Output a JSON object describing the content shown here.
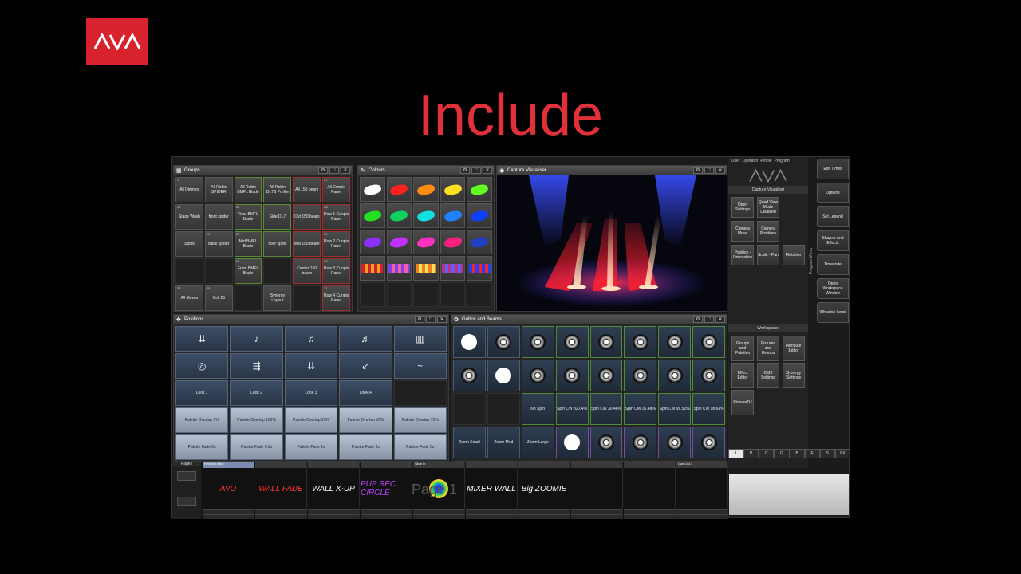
{
  "brand": {
    "logo_text": "AVO",
    "accent": "#d8232f"
  },
  "headline": "Include",
  "groups": {
    "title": "Groups",
    "cells": [
      {
        "n": "1",
        "label": "All Dimmer"
      },
      {
        "n": "",
        "label": "All Robin SPIDER"
      },
      {
        "n": "",
        "label": "All Robin BMFL Blade"
      },
      {
        "n": "",
        "label": "All Robin DL7S Profile"
      },
      {
        "n": "",
        "label": "All 150 beam"
      },
      {
        "n": "27",
        "label": "All Cunpix Panel"
      },
      {
        "n": "22",
        "label": "Stage Wash"
      },
      {
        "n": "",
        "label": "front spider"
      },
      {
        "n": "24",
        "label": "Rear BMFL Blade"
      },
      {
        "n": "",
        "label": "Side DL7"
      },
      {
        "n": "",
        "label": "Out 150 beam"
      },
      {
        "n": "28",
        "label": "Row 1 Cunpix Panel"
      },
      {
        "n": "",
        "label": "Spots"
      },
      {
        "n": "23",
        "label": "Back spider"
      },
      {
        "n": "25",
        "label": "Mid BMFL Blade"
      },
      {
        "n": "",
        "label": "floor spots"
      },
      {
        "n": "",
        "label": "Mid 150 beam"
      },
      {
        "n": "29",
        "label": "Row 2 Cunpix Panel"
      },
      {
        "n": "",
        "label": ""
      },
      {
        "n": "",
        "label": ""
      },
      {
        "n": "26",
        "label": "Front BMFL Blade"
      },
      {
        "n": "",
        "label": ""
      },
      {
        "n": "",
        "label": "Center 150 beam"
      },
      {
        "n": "30",
        "label": "Row 3 Cunpix Panel"
      },
      {
        "n": "33",
        "label": "All Moves"
      },
      {
        "n": "35",
        "label": "Cell 25"
      },
      {
        "n": "",
        "label": ""
      },
      {
        "n": "",
        "label": "Synergy Layout"
      },
      {
        "n": "",
        "label": ""
      },
      {
        "n": "31",
        "label": "Row 4 Cunpix Panel"
      }
    ]
  },
  "colours": {
    "title": "Colours"
  },
  "visualiser": {
    "title": "Capture Visualiser"
  },
  "positions": {
    "title": "Positions",
    "looks": [
      "Look 1",
      "Look 2",
      "Look 3",
      "Look 4"
    ],
    "overlaps": [
      "Palette Overlap 0%",
      "Palette Overlap 100%",
      "Palette Overlap 25%",
      "Palette Overlap 50%",
      "Palette Overlap 75%"
    ],
    "fades": [
      "Palette Fade 0s",
      "Palette Fade 0.5s",
      "Palette Fade 2s",
      "Palette Fade 3s",
      "Palette Fade 5s"
    ]
  },
  "gobos": {
    "title": "Gobos and Beams",
    "row3": [
      "No Spin",
      "Spin CW 82.04%",
      "Spin CW 30.46%",
      "Spin CW 35.48%",
      "Spin CW 99.52%",
      "Spin CW 98.63%"
    ],
    "row4": [
      "Zoom Small",
      "Zoom Med",
      "Zoom Large"
    ]
  },
  "operator_tabs": [
    "User",
    "Operator",
    "Profile",
    "Program"
  ],
  "right_panel": {
    "section1": "Capture Visualiser",
    "buttons1": [
      "Open Settings",
      "Quad View Mode Disabled",
      "Camera Move",
      "Camera Positions",
      "Position - Orientation",
      "Scale - Pan",
      "Rotation"
    ],
    "section2": "Workspaces",
    "buttons2": [
      "Groups and Palettes",
      "Fixtures and Groups",
      "Attribute Editor",
      "Effect Editor",
      "DMX Settings",
      "Synergy Settings",
      "PioneerDJ"
    ]
  },
  "side_buttons": [
    "Edit Times",
    "Options",
    "Set Legend",
    "Shapes And Effects",
    "Timecode",
    "Open Workspace Window",
    "Wheels= Level"
  ],
  "program_menu": "Program Menu",
  "filter_tabs": [
    "I",
    "P",
    "C",
    "G",
    "B",
    "E",
    "S",
    "FX"
  ],
  "pages": {
    "label": "Pages",
    "playbacks": [
      "Red And Blue",
      "",
      "",
      "",
      "Slide In",
      "",
      "",
      "",
      "",
      "Cue List 7"
    ],
    "handwritten": [
      "AVO",
      "WALL FADE",
      "WALL X-UP",
      "PUP REC CIRCLE",
      "",
      "MIXER WALL",
      "Big ZOOMIE"
    ],
    "watermark": "Page 1"
  }
}
